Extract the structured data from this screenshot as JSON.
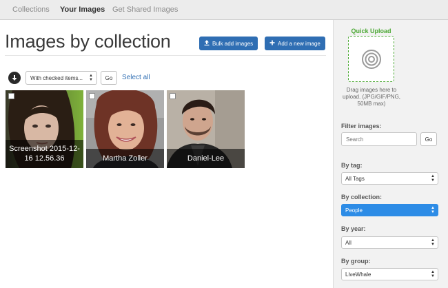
{
  "nav": {
    "tabs": [
      {
        "label": "Collections"
      },
      {
        "label": "Your Images"
      },
      {
        "label": "Get Shared Images"
      }
    ]
  },
  "main": {
    "title": "Images by collection",
    "bulk_add_label": "Bulk add images",
    "add_new_label": "Add a new image",
    "bulk_action_select": "With checked items...",
    "go_label": "Go",
    "select_all_label": "Select all",
    "images": [
      {
        "caption": "Screenshot 2015-12-16 12.56.36"
      },
      {
        "caption": "Martha Zoller"
      },
      {
        "caption": "Daniel-Lee"
      }
    ]
  },
  "sidebar": {
    "quick_upload_title": "Quick Upload",
    "dropzone_text": "Drag images here to upload. (JPG/GIF/PNG, 50MB max)",
    "filter_label": "Filter images:",
    "search_placeholder": "Search",
    "go_label": "Go",
    "by_tag_label": "By tag:",
    "by_tag_value": "All Tags",
    "by_collection_label": "By collection:",
    "by_collection_value": "People",
    "by_year_label": "By year:",
    "by_year_value": "All",
    "by_group_label": "By group:",
    "by_group_value": "LiveWhale"
  },
  "colors": {
    "primary_button": "#2f6eb3",
    "upload_green": "#4aa832",
    "selected_option": "#2d8ce6"
  },
  "icons": {
    "bulk_add": "upload-icon",
    "add_new": "plus-icon",
    "bulk_actions": "circle-arrow-down-icon",
    "dropzone": "target-icon"
  }
}
